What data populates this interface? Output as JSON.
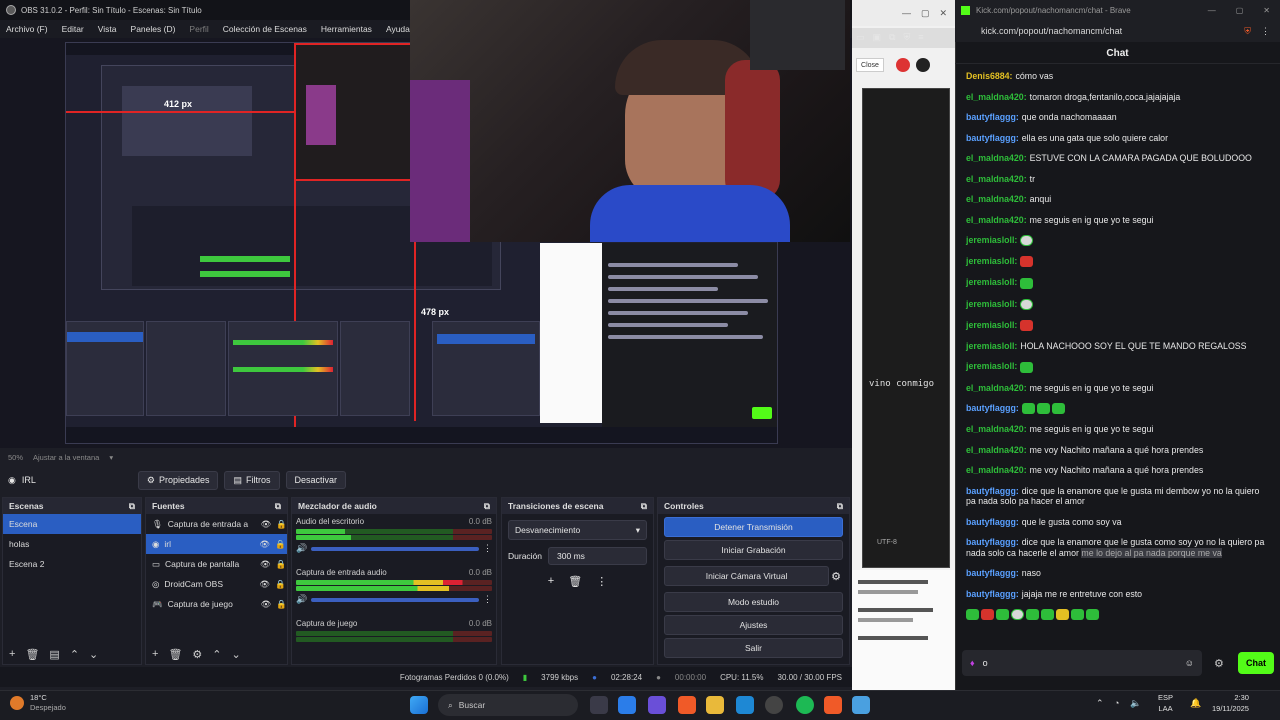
{
  "obs": {
    "title": "OBS 31.0.2 - Perfil: Sin Título - Escenas: Sin Título",
    "menu": [
      "Archivo (F)",
      "Editar",
      "Vista",
      "Paneles (D)",
      "Perfil",
      "Colección de Escenas",
      "Herramientas",
      "Ayuda (H)"
    ],
    "preview_status": [
      "50%",
      "Ajustar a la ventana"
    ],
    "nested_px_1": "412 px",
    "nested_px_2": "478 px",
    "source_toolbar": {
      "source": "IRL",
      "properties": "Propiedades",
      "filters": "Filtros",
      "deactivate": "Desactivar"
    },
    "scenes": {
      "title": "Escenas",
      "items": [
        "Escena",
        "holas",
        "Escena 2"
      ]
    },
    "sources": {
      "title": "Fuentes",
      "items": [
        "Captura de entrada a",
        "irl",
        "Captura de pantalla",
        "DroidCam OBS",
        "Captura de juego"
      ]
    },
    "mixer": {
      "title": "Mezclador de audio",
      "tracks": [
        {
          "name": "Audio del escritorio",
          "db": "0.0 dB"
        },
        {
          "name": "Captura de entrada audio",
          "db": "0.0 dB"
        },
        {
          "name": "Captura de juego",
          "db": "0.0 dB"
        }
      ]
    },
    "transitions": {
      "title": "Transiciones de escena",
      "selected": "Desvanecimiento",
      "duration_label": "Duración",
      "duration_value": "300 ms"
    },
    "controls": {
      "title": "Controles",
      "buttons": [
        "Detener Transmisión",
        "Iniciar Grabación",
        "Iniciar Cámara Virtual",
        "Modo estudio",
        "Ajustes",
        "Salir"
      ]
    },
    "status": {
      "dropped": "Fotogramas Perdidos 0 (0.0%)",
      "bitrate": "3799 kbps",
      "stream_time": "02:28:24",
      "rec_time": "00:00:00",
      "cpu": "CPU: 11.5%",
      "fps": "30.00 / 30.00 FPS"
    }
  },
  "middle": {
    "tab_label": "Close",
    "text": "vino conmigo",
    "encoding": "UTF-8"
  },
  "chat": {
    "window_title": "Kick.com/popout/nachomancm/chat - Brave",
    "url": "kick.com/popout/nachomancm/chat",
    "header": "Chat",
    "messages": [
      {
        "user": "Denis6884:",
        "text": "cómo vas",
        "color": "#e3c023",
        "emotes": []
      },
      {
        "user": "el_maldna420:",
        "text": "tomaron droga,fentanilo,coca.jajajajaja",
        "color": "#2ebd3a",
        "emotes": []
      },
      {
        "user": "bautyflaggg:",
        "text": "que onda nachomaaaan",
        "color": "#5aa0ff",
        "emotes": []
      },
      {
        "user": "bautyflaggg:",
        "text": "ella es una gata que solo quiere calor",
        "color": "#5aa0ff",
        "emotes": []
      },
      {
        "user": "el_maldna420:",
        "text": "ESTUVE CON LA CAMARA PAGADA QUE BOLUDOOO",
        "color": "#2ebd3a",
        "emotes": []
      },
      {
        "user": "el_maldna420:",
        "text": "tr",
        "color": "#2ebd3a",
        "emotes": []
      },
      {
        "user": "el_maldna420:",
        "text": "anqui",
        "color": "#2ebd3a",
        "emotes": []
      },
      {
        "user": "el_maldna420:",
        "text": "me seguis en ig que yo te segui",
        "color": "#2ebd3a",
        "emotes": []
      },
      {
        "user": "jeremiasloll:",
        "text": "",
        "color": "#2ebd3a",
        "emotes": [
          "skull"
        ]
      },
      {
        "user": "jeremiasloll:",
        "text": "",
        "color": "#2ebd3a",
        "emotes": [
          "red"
        ]
      },
      {
        "user": "jeremiasloll:",
        "text": "",
        "color": "#2ebd3a",
        "emotes": [
          "green"
        ]
      },
      {
        "user": "jeremiasloll:",
        "text": "",
        "color": "#2ebd3a",
        "emotes": [
          "skull"
        ]
      },
      {
        "user": "jeremiasloll:",
        "text": "",
        "color": "#2ebd3a",
        "emotes": [
          "red"
        ]
      },
      {
        "user": "jeremiasloll:",
        "text": "HOLA NACHOOO SOY EL QUE TE MANDO REGALOSS",
        "color": "#2ebd3a",
        "emotes": []
      },
      {
        "user": "jeremiasloll:",
        "text": "",
        "color": "#2ebd3a",
        "emotes": [
          "green"
        ]
      },
      {
        "user": "el_maldna420:",
        "text": "me seguis en ig que yo te segui",
        "color": "#2ebd3a",
        "emotes": []
      },
      {
        "user": "bautyflaggg:",
        "text": "",
        "color": "#5aa0ff",
        "emotes": [
          "green",
          "green",
          "green"
        ]
      },
      {
        "user": "el_maldna420:",
        "text": "me seguis en ig que yo te segui",
        "color": "#2ebd3a",
        "emotes": []
      },
      {
        "user": "el_maldna420:",
        "text": "me voy Nachito mañana a qué hora prendes",
        "color": "#2ebd3a",
        "emotes": []
      },
      {
        "user": "el_maldna420:",
        "text": "me voy Nachito mañana a qué hora prendes",
        "color": "#2ebd3a",
        "emotes": []
      },
      {
        "user": "bautyflaggg:",
        "text": "dice que la enamore que le gusta mi dembow yo no la quiero pa nada solo pa hacer el amor",
        "color": "#5aa0ff",
        "emotes": []
      },
      {
        "user": "bautyflaggg:",
        "text": "que le gusta como soy va",
        "color": "#5aa0ff",
        "emotes": []
      },
      {
        "user": "bautyflaggg:",
        "text": "dice que la enamore que le gusta como soy yo no la quiero pa nada solo ca hacerle el amor",
        "color": "#5aa0ff",
        "emotes": [],
        "highlight": "me lo dejo al pa nada porque me va"
      },
      {
        "user": "bautyflaggg:",
        "text": "naso",
        "color": "#5aa0ff",
        "emotes": []
      },
      {
        "user": "bautyflaggg:",
        "text": "jajaja me re entretuve con esto",
        "color": "#5aa0ff",
        "emotes": []
      }
    ],
    "input_value": "o",
    "send_label": "Chat"
  },
  "taskbar": {
    "weather_temp": "18°C",
    "weather_desc": "Despejado",
    "search_placeholder": "Buscar",
    "lang_1": "ESP",
    "lang_2": "LAA",
    "time": "2:30",
    "date": "19/11/2025"
  }
}
